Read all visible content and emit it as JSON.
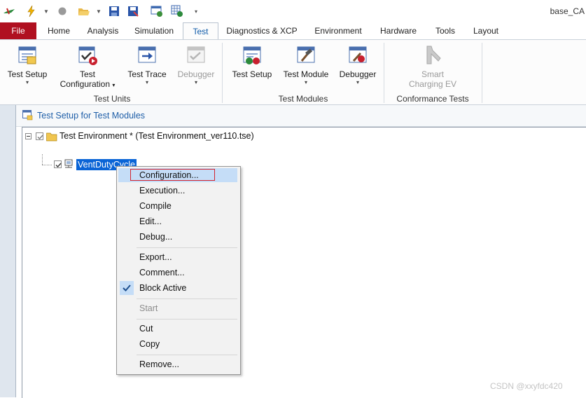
{
  "app": {
    "title": "base_CA"
  },
  "tabs": {
    "file": "File",
    "items": [
      "Home",
      "Analysis",
      "Simulation",
      "Test",
      "Diagnostics & XCP",
      "Environment",
      "Hardware",
      "Tools",
      "Layout"
    ],
    "active": "Test"
  },
  "ribbon": {
    "test_units": {
      "group_label": "Test Units",
      "test_setup": "Test Setup",
      "test_configuration_line1": "Test",
      "test_configuration_line2": "Configuration",
      "test_trace": "Test Trace",
      "debugger": "Debugger"
    },
    "test_modules": {
      "group_label": "Test Modules",
      "test_setup": "Test Setup",
      "test_module": "Test Module",
      "debugger": "Debugger"
    },
    "conformance": {
      "group_label": "Conformance Tests",
      "smart_line1": "Smart",
      "smart_line2": "Charging EV"
    }
  },
  "panel": {
    "title": "Test Setup for Test Modules",
    "tree": {
      "root_label": "Test Environment *  (Test Environment_ver110.tse)",
      "child_label": "VentDutyCycle"
    }
  },
  "context_menu": {
    "configuration": "Configuration...",
    "execution": "Execution...",
    "compile": "Compile",
    "edit": "Edit...",
    "debug": "Debug...",
    "export": "Export...",
    "comment": "Comment...",
    "block_active": "Block Active",
    "start": "Start",
    "cut": "Cut",
    "copy": "Copy",
    "remove": "Remove..."
  },
  "watermark": "CSDN @xxyfdc420",
  "colors": {
    "file_tab": "#b01020",
    "active_tab_text": "#0e5aa8",
    "selection": "#0a64d6",
    "menu_highlight": "#c5ddf7",
    "highlight_box": "#d2232f"
  }
}
